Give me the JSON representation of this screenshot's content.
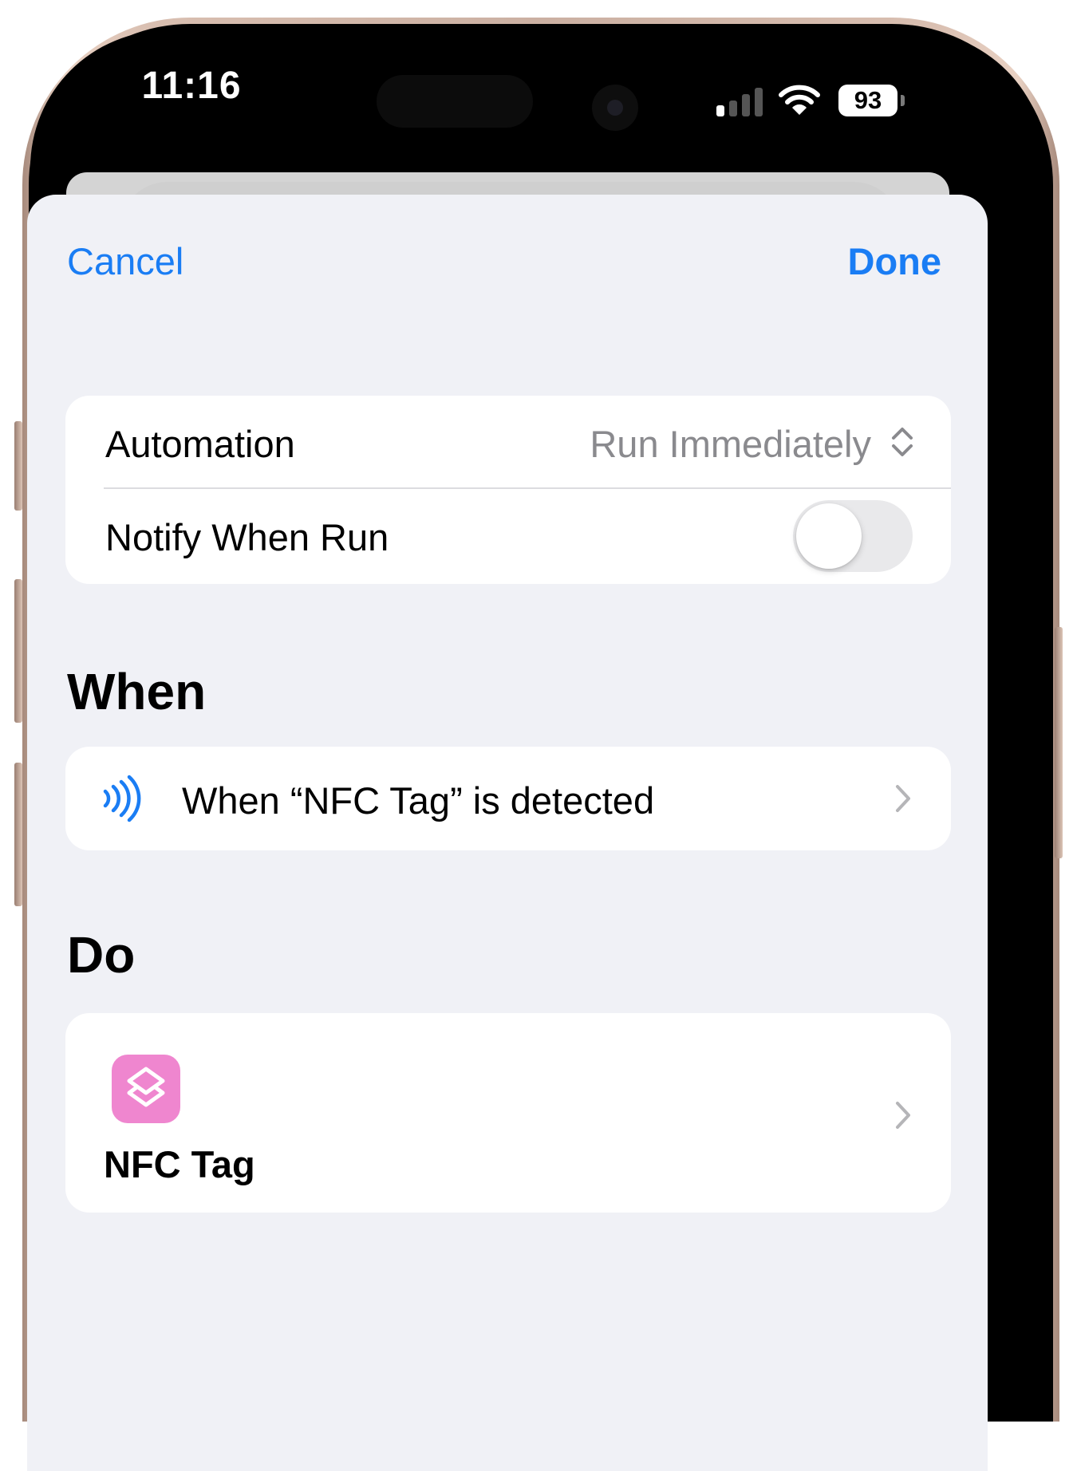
{
  "status_bar": {
    "time": "11:16",
    "battery": "93"
  },
  "nav": {
    "cancel_label": "Cancel",
    "done_label": "Done"
  },
  "settings": {
    "automation_label": "Automation",
    "automation_value": "Run Immediately",
    "notify_label": "Notify When Run",
    "notify_enabled": false
  },
  "when_section": {
    "title": "When",
    "trigger_label": "When “NFC Tag” is detected",
    "trigger_icon": "nfc-icon"
  },
  "do_section": {
    "title": "Do",
    "shortcut_name": "NFC Tag",
    "shortcut_icon": "shortcuts-icon",
    "shortcut_icon_color": "#ef86cf"
  },
  "colors": {
    "accent": "#1a7df4",
    "background": "#f0f1f6",
    "card": "#ffffff",
    "secondary_text": "#8a8a8e"
  }
}
